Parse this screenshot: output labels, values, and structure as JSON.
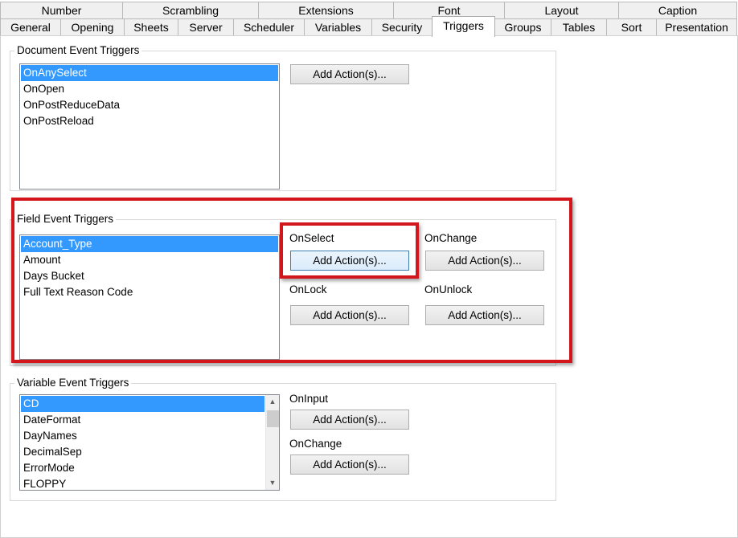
{
  "tabs_row1": [
    "Number",
    "Scrambling",
    "Extensions",
    "Font",
    "Layout",
    "Caption"
  ],
  "tabs_row2": [
    "General",
    "Opening",
    "Sheets",
    "Server",
    "Scheduler",
    "Variables",
    "Security",
    "Triggers",
    "Groups",
    "Tables",
    "Sort",
    "Presentation"
  ],
  "active_tab": "Triggers",
  "document_triggers": {
    "title": "Document Event Triggers",
    "items": [
      "OnAnySelect",
      "OnOpen",
      "OnPostReduceData",
      "OnPostReload"
    ],
    "selected": "OnAnySelect",
    "add_button": "Add Action(s)..."
  },
  "field_triggers": {
    "title": "Field Event Triggers",
    "items": [
      "Account_Type",
      "Amount",
      "Days Bucket",
      "Full Text Reason Code"
    ],
    "selected": "Account_Type",
    "on_select_label": "OnSelect",
    "on_change_label": "OnChange",
    "on_lock_label": "OnLock",
    "on_unlock_label": "OnUnlock",
    "add_button": "Add Action(s)..."
  },
  "variable_triggers": {
    "title": "Variable Event Triggers",
    "items": [
      "CD",
      "DateFormat",
      "DayNames",
      "DecimalSep",
      "ErrorMode",
      "FLOPPY"
    ],
    "selected": "CD",
    "on_input_label": "OnInput",
    "on_change_label": "OnChange",
    "add_button": "Add Action(s)..."
  },
  "colors": {
    "selection": "#3399ff",
    "highlight": "#d3151c"
  },
  "scroll": {
    "up_icon": "▲",
    "down_icon": "▼"
  }
}
